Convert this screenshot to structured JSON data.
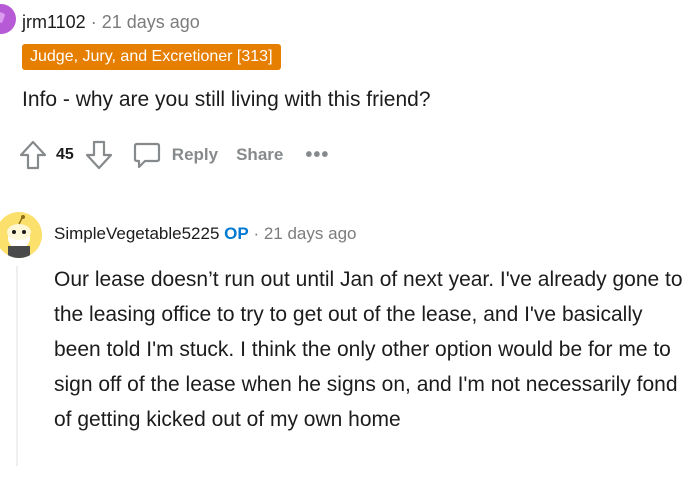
{
  "comment1": {
    "username": "jrm1102",
    "time": "21 days ago",
    "flair": "Judge, Jury, and Excretioner [313]",
    "body": "Info - why are you still living with this friend?",
    "votes": "45",
    "reply_label": "Reply",
    "share_label": "Share",
    "more_label": "•••"
  },
  "comment2": {
    "username": "SimpleVegetable5225",
    "op_badge": "OP",
    "time": "21 days ago",
    "body": "Our lease doesn’t run out until Jan of next year. I've already gone to the leasing office to try to get out of the lease, and I've basically been told I'm stuck. I think the only other option would be for me to sign off of the lease when he signs on, and I'm not necessarily fond of getting kicked out of my own home"
  },
  "colors": {
    "flair_bg": "#e67e00",
    "op_blue": "#0079d3",
    "meta_gray": "#7c7c7c",
    "action_gray": "#878a8c"
  }
}
